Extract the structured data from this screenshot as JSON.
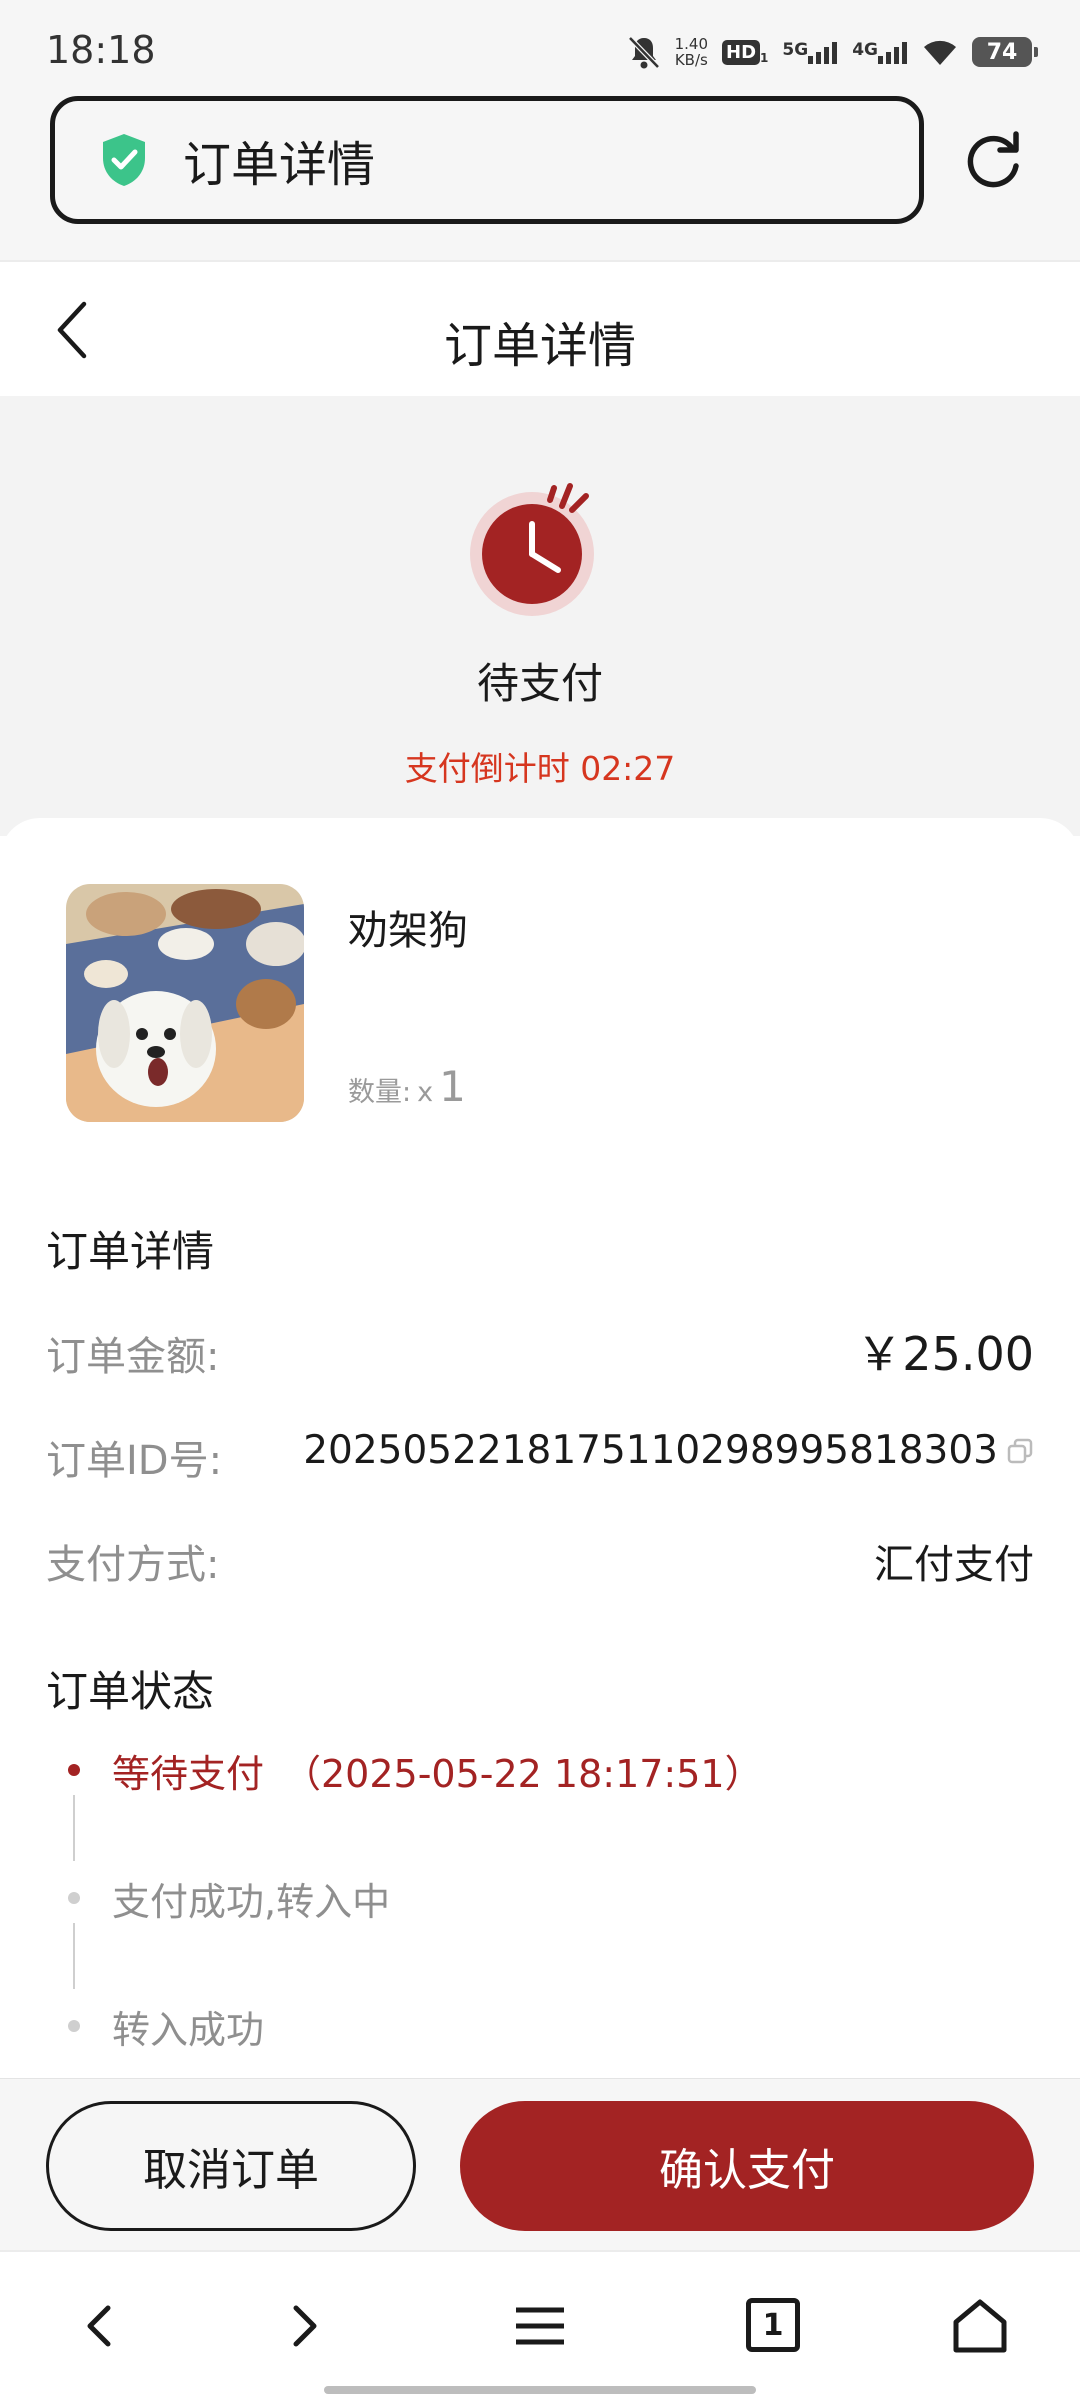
{
  "status_bar": {
    "time": "18:18",
    "net_speed_value": "1.40",
    "net_speed_unit": "KB/s",
    "hd_label": "HD",
    "sim1_label": "5G",
    "sim2_label": "4G",
    "battery": "74",
    "icons": [
      "mute-bell-icon",
      "hd-icon",
      "signal-5g-icon",
      "signal-4g-icon",
      "wifi-icon",
      "battery-icon"
    ]
  },
  "browser": {
    "url_title": "订单详情",
    "security_icon": "shield-check-icon",
    "refresh_icon": "refresh-icon"
  },
  "header": {
    "title": "订单详情",
    "back_icon": "chevron-left-icon"
  },
  "status": {
    "icon": "clock-icon",
    "title": "待支付",
    "countdown": "支付倒计时 02:27"
  },
  "product": {
    "name": "劝架狗",
    "qty_label": "数量:",
    "qty_prefix": "x",
    "qty_value": "1"
  },
  "details": {
    "title": "订单详情",
    "amount_label": "订单金额:",
    "amount_value": "￥25.00",
    "id_label": "订单ID号:",
    "id_value": "20250522181751102989958183​03",
    "method_label": "支付方式:",
    "method_value": "汇付支付"
  },
  "order_status": {
    "title": "订单状态",
    "steps": [
      {
        "text": "等待支付　（2025-05-22 18:17:51）",
        "active": true
      },
      {
        "text": "支付成功,转入中",
        "active": false
      },
      {
        "text": "转入成功",
        "active": false
      }
    ]
  },
  "actions": {
    "cancel": "取消订单",
    "pay": "确认支付"
  },
  "nav": {
    "tab_count": "1",
    "icons": [
      "back-arrow-icon",
      "forward-arrow-icon",
      "menu-icon",
      "tabs-icon",
      "home-icon"
    ]
  },
  "colors": {
    "accent": "#a32323",
    "countdown": "#d6361f",
    "safe_green": "#3cc48a"
  }
}
